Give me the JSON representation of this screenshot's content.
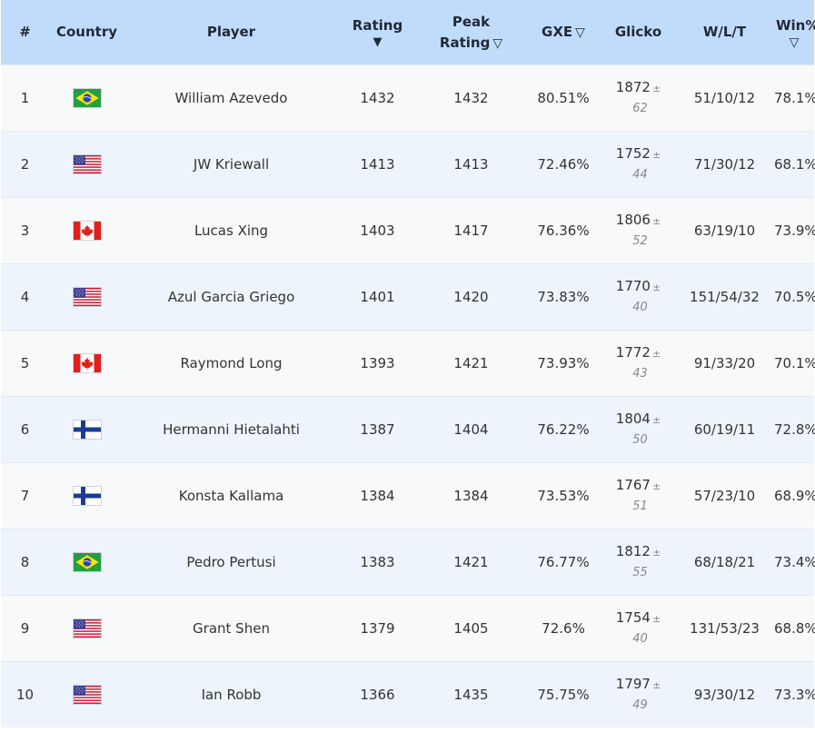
{
  "columns": {
    "rank": "#",
    "country": "Country",
    "player": "Player",
    "rating": "Rating",
    "rating_arrow": "▼",
    "peak_line1": "Peak",
    "peak_line2": "Rating",
    "peak_arrow": "▽",
    "gxe": "GXE",
    "gxe_arrow": "▽",
    "glicko": "Glicko",
    "wlt": "W/L/T",
    "win": "Win%",
    "win_arrow": "▽"
  },
  "plus_minus": "±",
  "rows": [
    {
      "rank": "1",
      "flag": "br-flag-icon",
      "player": "William Azevedo",
      "rating": "1432",
      "peak": "1432",
      "gxe": "80.51%",
      "glicko": "1872",
      "glicko_dev": "62",
      "wlt": "51/10/12",
      "win": "78.1%"
    },
    {
      "rank": "2",
      "flag": "us-flag-icon",
      "player": "JW Kriewall",
      "rating": "1413",
      "peak": "1413",
      "gxe": "72.46%",
      "glicko": "1752",
      "glicko_dev": "44",
      "wlt": "71/30/12",
      "win": "68.1%"
    },
    {
      "rank": "3",
      "flag": "ca-flag-icon",
      "player": "Lucas Xing",
      "rating": "1403",
      "peak": "1417",
      "gxe": "76.36%",
      "glicko": "1806",
      "glicko_dev": "52",
      "wlt": "63/19/10",
      "win": "73.9%"
    },
    {
      "rank": "4",
      "flag": "us-flag-icon",
      "player": "Azul Garcia Griego",
      "rating": "1401",
      "peak": "1420",
      "gxe": "73.83%",
      "glicko": "1770",
      "glicko_dev": "40",
      "wlt": "151/54/32",
      "win": "70.5%"
    },
    {
      "rank": "5",
      "flag": "ca-flag-icon",
      "player": "Raymond Long",
      "rating": "1393",
      "peak": "1421",
      "gxe": "73.93%",
      "glicko": "1772",
      "glicko_dev": "43",
      "wlt": "91/33/20",
      "win": "70.1%"
    },
    {
      "rank": "6",
      "flag": "fi-flag-icon",
      "player": "Hermanni Hietalahti",
      "rating": "1387",
      "peak": "1404",
      "gxe": "76.22%",
      "glicko": "1804",
      "glicko_dev": "50",
      "wlt": "60/19/11",
      "win": "72.8%"
    },
    {
      "rank": "7",
      "flag": "fi-flag-icon",
      "player": "Konsta Kallama",
      "rating": "1384",
      "peak": "1384",
      "gxe": "73.53%",
      "glicko": "1767",
      "glicko_dev": "51",
      "wlt": "57/23/10",
      "win": "68.9%"
    },
    {
      "rank": "8",
      "flag": "br-flag-icon",
      "player": "Pedro Pertusi",
      "rating": "1383",
      "peak": "1421",
      "gxe": "76.77%",
      "glicko": "1812",
      "glicko_dev": "55",
      "wlt": "68/18/21",
      "win": "73.4%"
    },
    {
      "rank": "9",
      "flag": "us-flag-icon",
      "player": "Grant Shen",
      "rating": "1379",
      "peak": "1405",
      "gxe": "72.6%",
      "glicko": "1754",
      "glicko_dev": "40",
      "wlt": "131/53/23",
      "win": "68.8%"
    },
    {
      "rank": "10",
      "flag": "us-flag-icon",
      "player": "Ian Robb",
      "rating": "1366",
      "peak": "1435",
      "gxe": "75.75%",
      "glicko": "1797",
      "glicko_dev": "49",
      "wlt": "93/30/12",
      "win": "73.3%"
    }
  ]
}
